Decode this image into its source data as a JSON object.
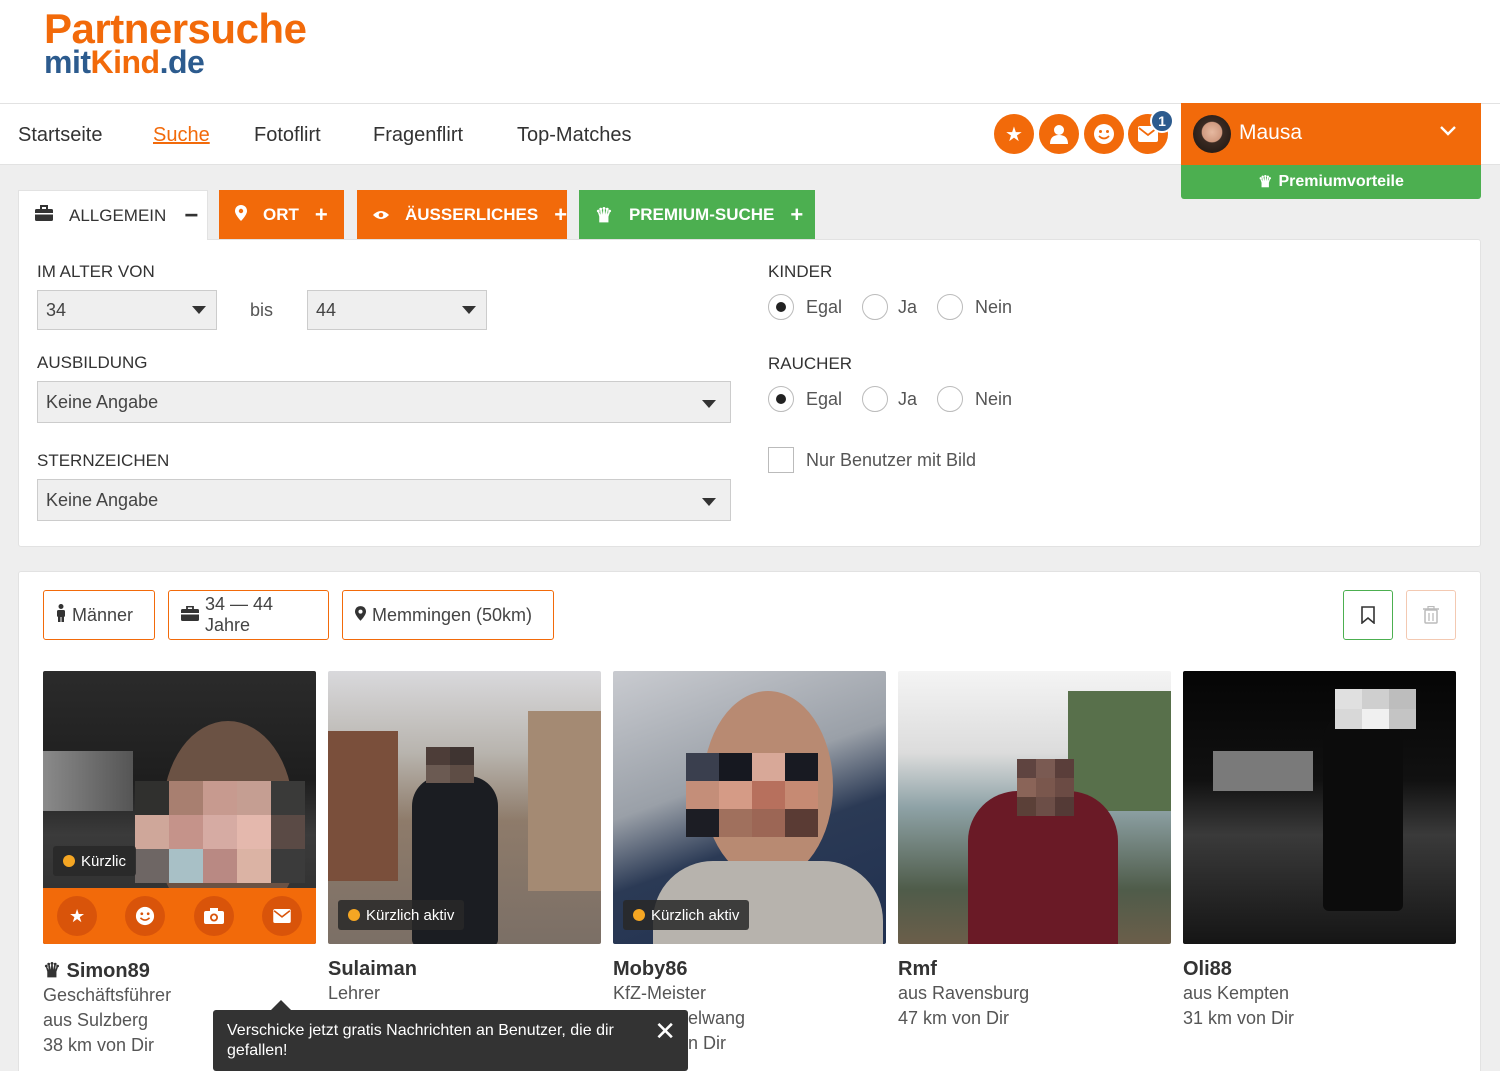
{
  "logo": {
    "line1": "Partnersuche",
    "line2a": "mit",
    "line2b": "Kind",
    "line2c": ".de"
  },
  "nav": {
    "items": [
      "Startseite",
      "Suche",
      "Fotoflirt",
      "Fragenflirt",
      "Top-Matches"
    ],
    "active": "Suche"
  },
  "header_icons": [
    "star-icon",
    "user-icon",
    "smile-icon",
    "mail-icon"
  ],
  "mail_badge": "1",
  "user": {
    "name": "Mausa",
    "premium": "Premiumvorteile"
  },
  "tabs": {
    "allgemein": "ALLGEMEIN",
    "ort": "ORT",
    "aeusserliches": "ÄUSSERLICHES",
    "premium": "PREMIUM-SUCHE"
  },
  "form": {
    "age_label": "IM ALTER VON",
    "age_from": "34",
    "bis": "bis",
    "age_to": "44",
    "ausbildung_label": "AUSBILDUNG",
    "ausbildung_value": "Keine Angabe",
    "sternzeichen_label": "STERNZEICHEN",
    "sternzeichen_value": "Keine Angabe",
    "kinder_label": "KINDER",
    "raucher_label": "RAUCHER",
    "options": [
      "Egal",
      "Ja",
      "Nein"
    ],
    "kinder_selected": "Egal",
    "raucher_selected": "Egal",
    "nur_bild": "Nur Benutzer mit Bild"
  },
  "filters": {
    "gender": "Männer",
    "age": "34 — 44 Jahre",
    "location": "Memmingen (50km)"
  },
  "cards": [
    {
      "name": "Simon89",
      "line1": "Geschäftsführer",
      "line2": "aus Sulzberg",
      "line3": "38 km von Dir",
      "badge": "Kürzlic",
      "premium": true
    },
    {
      "name": "Sulaiman",
      "line1": "Lehrer",
      "line2": "",
      "line3": "",
      "badge": "Kürzlich aktiv"
    },
    {
      "name": "Moby86",
      "line1": "KfZ-Meister",
      "line2": "elwang",
      "line3": "n Dir",
      "badge": "Kürzlich aktiv"
    },
    {
      "name": "Rmf",
      "line1": "aus Ravensburg",
      "line2": "47 km von Dir",
      "line3": "",
      "badge": ""
    },
    {
      "name": "Oli88",
      "line1": "aus Kempten",
      "line2": "31 km von Dir",
      "line3": "",
      "badge": ""
    }
  ],
  "toast": "Verschicke jetzt gratis Nachrichten an Benutzer, die dir gefallen!",
  "colors": {
    "orange": "#f26a0a",
    "blue": "#2c5b8e",
    "green": "#4caf50"
  }
}
